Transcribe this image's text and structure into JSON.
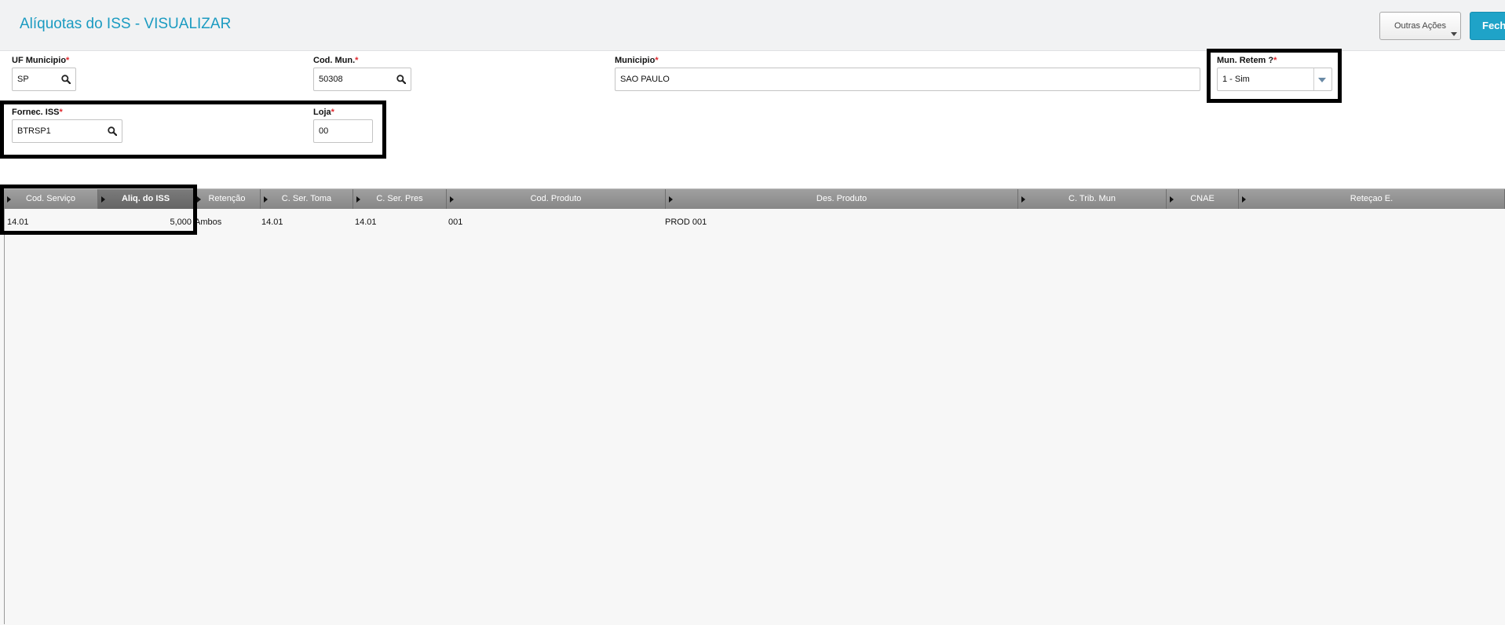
{
  "header": {
    "title": "Alíquotas do ISS - VISUALIZAR",
    "outras_acoes_label": "Outras Ações",
    "fechar_label": "Fechar"
  },
  "form": {
    "uf_municipio": {
      "label": "UF Municipio",
      "required": "*",
      "value": "SP"
    },
    "cod_mun": {
      "label": "Cod. Mun.",
      "required": "*",
      "value": "50308"
    },
    "municipio": {
      "label": "Municipio",
      "required": "*",
      "value": "SAO PAULO"
    },
    "mun_retem": {
      "label": "Mun. Retem ?",
      "required": "*",
      "value": "1 - Sim"
    },
    "fornec_iss": {
      "label": "Fornec. ISS",
      "required": "*",
      "value": "BTRSP1"
    },
    "loja": {
      "label": "Loja",
      "required": "*",
      "value": "00"
    }
  },
  "grid": {
    "columns": [
      "Cod. Serviço",
      "Aliq. do ISS",
      "Retenção",
      "C. Ser. Toma",
      "C. Ser. Pres",
      "Cod. Produto",
      "Des. Produto",
      "C. Trib. Mun",
      "CNAE",
      "Reteçao E."
    ],
    "active_column": "Aliq. do ISS",
    "rows": [
      [
        "14.01",
        "5,000",
        "Ambos",
        "14.01",
        "14.01",
        "001",
        "PROD 001",
        "",
        "",
        ""
      ]
    ]
  },
  "colors": {
    "title": "#1b9bc1",
    "primary_button": "#1fa3c8",
    "required_mark": "#e0282e",
    "grid_header": "#8f8f8f",
    "highlight_border": "#000000"
  },
  "icons": {
    "lookup": "magnifier",
    "dropdown": "chevron-down",
    "column_marker": "triangle-right"
  }
}
